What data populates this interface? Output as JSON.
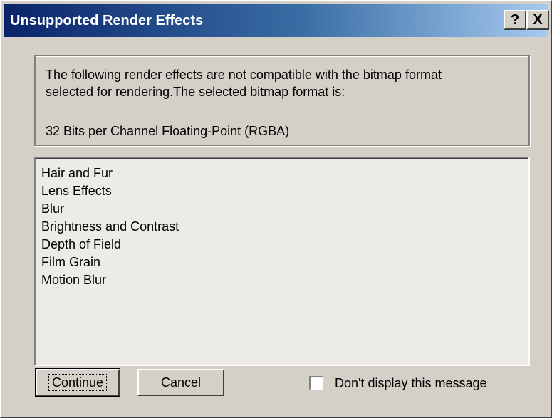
{
  "window": {
    "title": "Unsupported Render Effects",
    "help_button": "?",
    "close_button": "X"
  },
  "info": {
    "line1": "The following render effects are not compatible with the bitmap format",
    "line2": "selected for rendering.The selected bitmap format is:",
    "format": "32 Bits per Channel Floating-Point (RGBA)"
  },
  "effects": [
    "Hair and Fur",
    "Lens Effects",
    "Blur",
    "Brightness and Contrast",
    "Depth of Field",
    "Film Grain",
    "Motion Blur"
  ],
  "buttons": {
    "continue": "Continue",
    "cancel": "Cancel"
  },
  "checkbox": {
    "label": "Don't display this message",
    "checked": false
  },
  "colors": {
    "title_gradient_start": "#0a246a",
    "title_gradient_end": "#a6caf0",
    "dialog_face": "#d4d0c8"
  }
}
